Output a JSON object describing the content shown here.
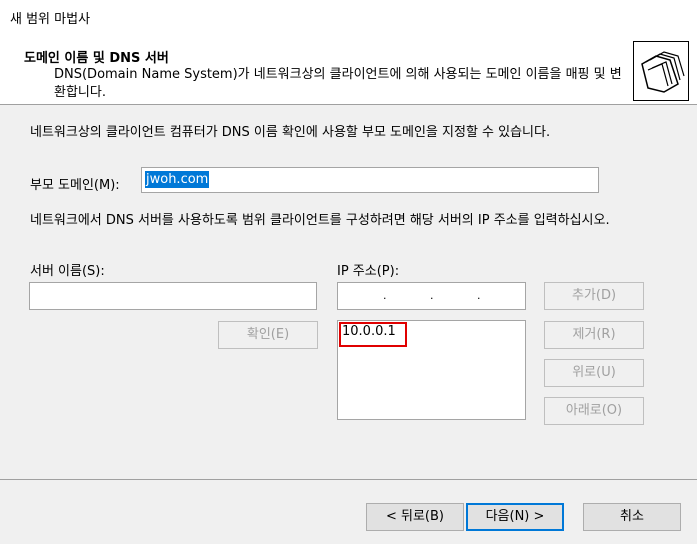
{
  "window": {
    "title": "새 범위 마법사"
  },
  "header": {
    "title": "도메인 이름 및 DNS 서버",
    "description": "DNS(Domain Name System)가 네트워크상의 클라이언트에 의해 사용되는 도메인 이름을 매핑 및 변환합니다."
  },
  "main": {
    "intro": "네트워크상의 클라이언트 컴퓨터가 DNS 이름 확인에 사용할 부모 도메인을 지정할 수 있습니다.",
    "parent_domain": {
      "label": "부모 도메인(M):",
      "value": "jwoh.com"
    },
    "config_text": "네트워크에서 DNS 서버를 사용하도록 범위 클라이언트를 구성하려면 해당 서버의 IP 주소를 입력하십시오.",
    "server_name": {
      "label": "서버 이름(S):",
      "value": ""
    },
    "ip_address": {
      "label": "IP 주소(P):",
      "dots": [
        ".",
        ".",
        "."
      ]
    },
    "resolve_label": "확인(E)",
    "ip_list": [
      "10.0.0.1"
    ],
    "buttons": {
      "add": "추가(D)",
      "remove": "제거(R)",
      "up": "위로(U)",
      "down": "아래로(O)"
    },
    "highlight_color": "#e00000"
  },
  "footer": {
    "back": "< 뒤로(B)",
    "next": "다음(N) >",
    "cancel": "취소"
  }
}
